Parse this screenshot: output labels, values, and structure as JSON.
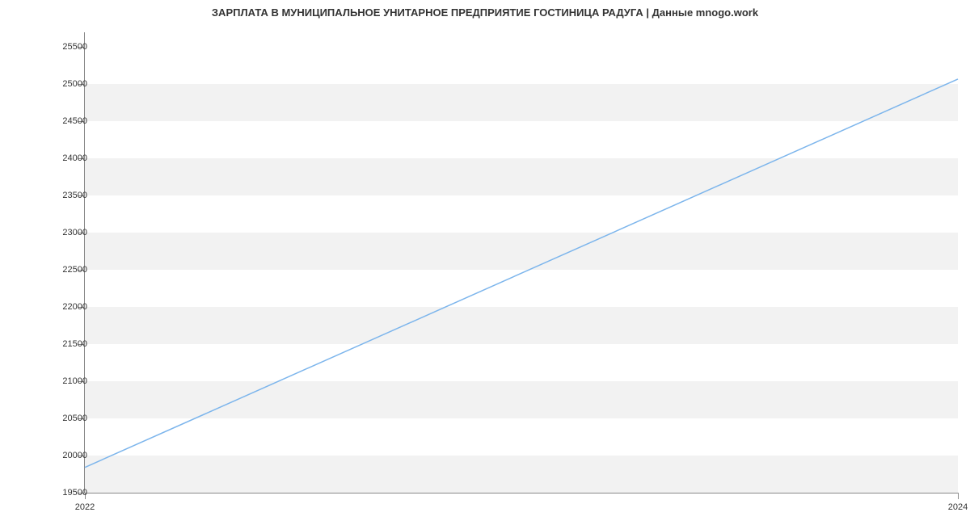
{
  "chart_data": {
    "type": "line",
    "title": "ЗАРПЛАТА В МУНИЦИПАЛЬНОЕ УНИТАРНОЕ ПРЕДПРИЯТИЕ ГОСТИНИЦА РАДУГА | Данные mnogo.work",
    "x": [
      2022,
      2024
    ],
    "values": [
      19841,
      25070
    ],
    "x_ticks": [
      2022,
      2024
    ],
    "y_ticks": [
      19500,
      20000,
      20500,
      21000,
      21500,
      22000,
      22500,
      23000,
      23500,
      24000,
      24500,
      25000,
      25500
    ],
    "ylim": [
      19500,
      25700
    ],
    "xlim": [
      2022,
      2024
    ],
    "line_color": "#7cb5ec",
    "xlabel": "",
    "ylabel": ""
  }
}
